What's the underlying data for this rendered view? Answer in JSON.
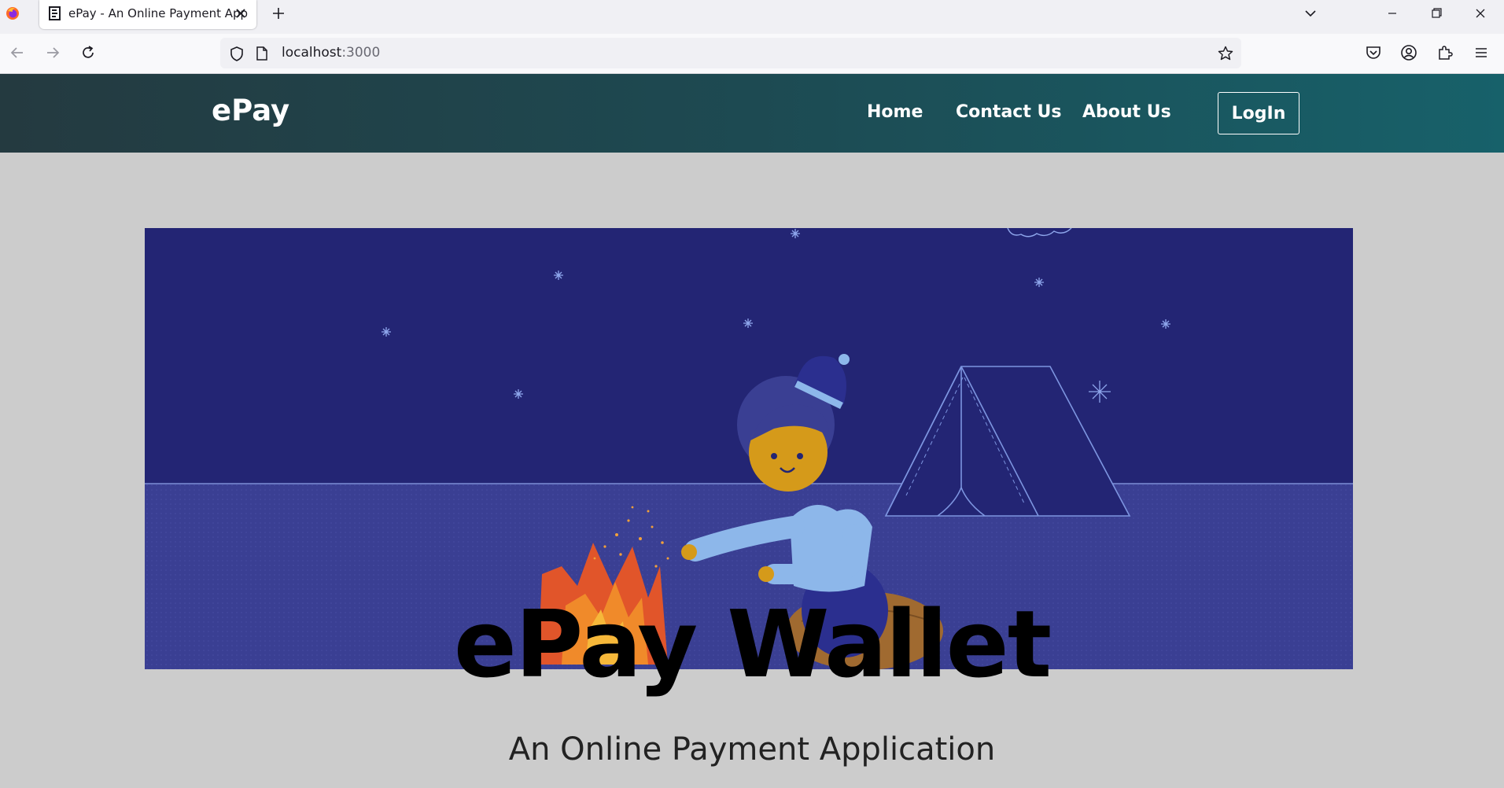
{
  "browser": {
    "tab_title": "ePay - An Online Payment App",
    "url_host": "localhost",
    "url_port": ":3000"
  },
  "site": {
    "brand": "ePay",
    "nav": {
      "home": "Home",
      "contact": "Contact Us",
      "about": "About Us",
      "login": "LogIn"
    }
  },
  "hero": {
    "title": "ePay Wallet",
    "subtitle": "An Online Payment Application"
  },
  "colors": {
    "header_start": "#243a40",
    "header_end": "#17616a",
    "page_bg": "#cccccc",
    "sky": "#232574",
    "ground": "#3a3f93"
  }
}
